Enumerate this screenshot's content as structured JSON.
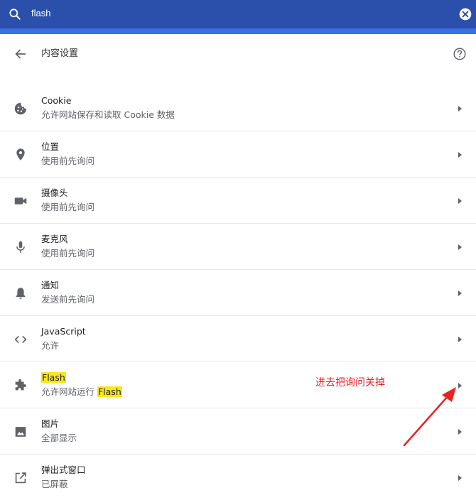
{
  "search": {
    "query": "flash"
  },
  "header": {
    "title": "内容设置"
  },
  "items": [
    {
      "title": "Cookie",
      "subtitle": "允许网站保存和读取 Cookie 数据",
      "icon": "cookie-icon"
    },
    {
      "title": "位置",
      "subtitle": "使用前先询问",
      "icon": "location-pin-icon"
    },
    {
      "title": "摄像头",
      "subtitle": "使用前先询问",
      "icon": "camera-icon"
    },
    {
      "title": "麦克风",
      "subtitle": "使用前先询问",
      "icon": "microphone-icon"
    },
    {
      "title": "通知",
      "subtitle": "发送前先询问",
      "icon": "bell-icon"
    },
    {
      "title": "JavaScript",
      "subtitle": "允许",
      "icon": "code-icon"
    },
    {
      "title": "Flash",
      "subtitle_prefix": "允许网站运行 ",
      "subtitle_highlight": "Flash",
      "icon": "puzzle-icon"
    },
    {
      "title": "图片",
      "subtitle": "全部显示",
      "icon": "image-icon"
    },
    {
      "title": "弹出式窗口",
      "subtitle": "已屏蔽",
      "icon": "open-in-new-icon"
    }
  ],
  "annotation": {
    "text": "进去把询问关掉",
    "color": "#e02020"
  },
  "colors": {
    "search_bar": "#2a50ac",
    "accent": "#3b6fe3",
    "highlight": "#f8e71c"
  }
}
